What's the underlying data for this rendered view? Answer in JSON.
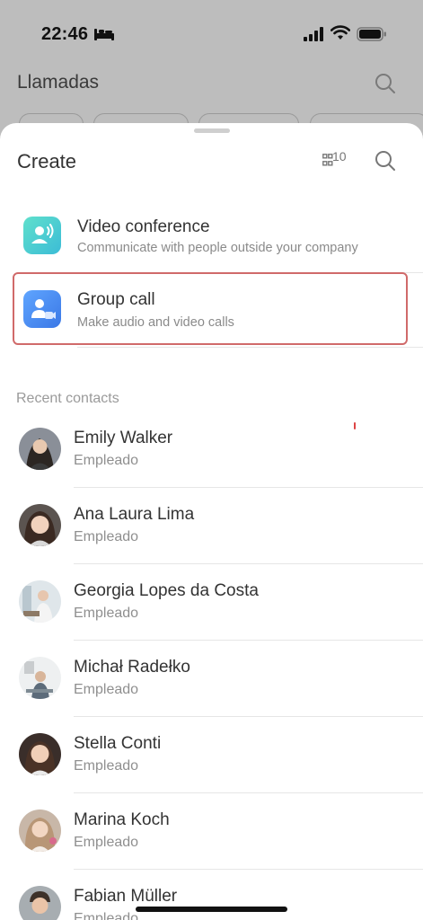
{
  "status_bar": {
    "time": "22:46"
  },
  "background": {
    "title": "Llamadas"
  },
  "sheet": {
    "title": "Create",
    "qr_badge": "10",
    "options": [
      {
        "title": "Video conference",
        "subtitle": "Communicate with people outside your company",
        "icon": "video-conference-icon",
        "color": "#4fd1c5"
      },
      {
        "title": "Group call",
        "subtitle": "Make audio and video calls",
        "icon": "group-call-icon",
        "color": "#4a8ef0"
      }
    ],
    "recent_label": "Recent contacts",
    "contacts": [
      {
        "name": "Emily Walker",
        "role": "Empleado"
      },
      {
        "name": "Ana Laura Lima",
        "role": "Empleado"
      },
      {
        "name": "Georgia Lopes da Costa",
        "role": "Empleado"
      },
      {
        "name": "Michał Radełko",
        "role": "Empleado"
      },
      {
        "name": "Stella Conti",
        "role": "Empleado"
      },
      {
        "name": "Marina Koch",
        "role": "Empleado"
      },
      {
        "name": "Fabian Müller",
        "role": "Empleado"
      }
    ]
  },
  "colors": {
    "highlight": "#d06a6a",
    "accent_teal": "#4fd1c5",
    "accent_blue": "#4a8ef0"
  }
}
